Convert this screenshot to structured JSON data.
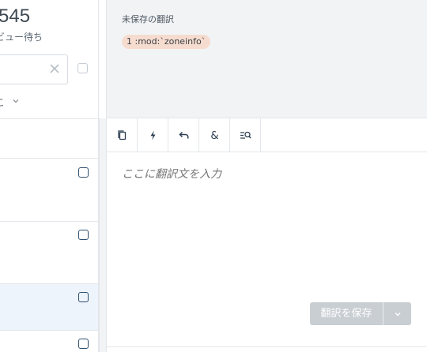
{
  "left": {
    "stat_number": "545",
    "stat_label": "ビュー待ち",
    "sort_label": "こ"
  },
  "source": {
    "title": "未保存の翻訳",
    "chip_text": "1 :mod:`zoneinfo`"
  },
  "toolbar": {
    "tools": [
      "copy-icon",
      "lightning-icon",
      "undo-icon",
      "ampersand-icon",
      "search-list-icon"
    ]
  },
  "editor": {
    "placeholder": "ここに翻訳文を入力",
    "save_label": "翻訳を保存"
  }
}
